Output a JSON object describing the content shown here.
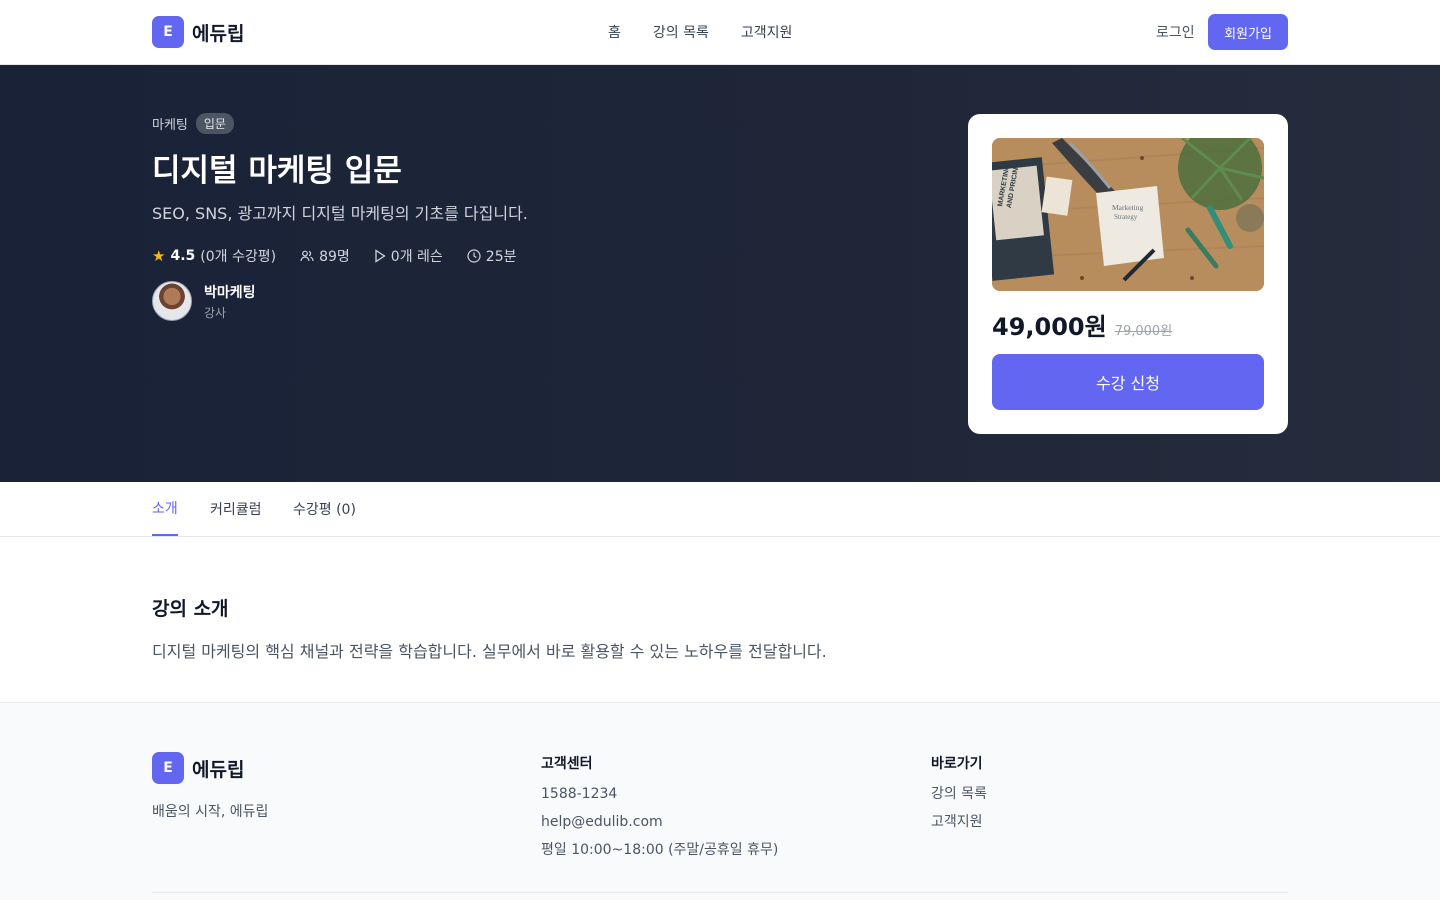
{
  "header": {
    "logo_letter": "E",
    "logo_text": "에듀립",
    "nav": [
      "홈",
      "강의 목록",
      "고객지원"
    ],
    "login": "로그인",
    "signup": "회원가입"
  },
  "course": {
    "category": "마케팅",
    "level": "입문",
    "title": "디지털 마케팅 입문",
    "description": "SEO, SNS, 광고까지 디지털 마케팅의 기초를 다집니다.",
    "rating": "4.5",
    "review_count": "(0개 수강평)",
    "students": "89명",
    "lessons": "0개 레슨",
    "duration": "25분",
    "instructor_name": "박마케팅",
    "instructor_role": "강사",
    "thumbnail_text": [
      "MARKETING",
      "AND PRICING",
      "Marketing",
      "Strategy"
    ],
    "price": "49,000원",
    "original_price": "79,000원",
    "enroll": "수강 신청"
  },
  "tabs": [
    "소개",
    "커리큘럼",
    "수강평 (0)"
  ],
  "intro": {
    "title": "강의 소개",
    "body": "디지털 마케팅의 핵심 채널과 전략을 학습합니다. 실무에서 바로 활용할 수 있는 노하우를 전달합니다."
  },
  "footer": {
    "logo_letter": "E",
    "logo_text": "에듀립",
    "tagline": "배움의 시작, 에듀립",
    "support_title": "고객센터",
    "phone": "1588-1234",
    "email": "help@edulib.com",
    "hours": "평일 10:00~18:00 (주말/공휴일 휴무)",
    "links_title": "바로가기",
    "links": [
      "강의 목록",
      "고객지원"
    ]
  },
  "colors": {
    "accent": "#6366f1",
    "hero_bg": "#1e2638",
    "star": "#f5b817"
  }
}
